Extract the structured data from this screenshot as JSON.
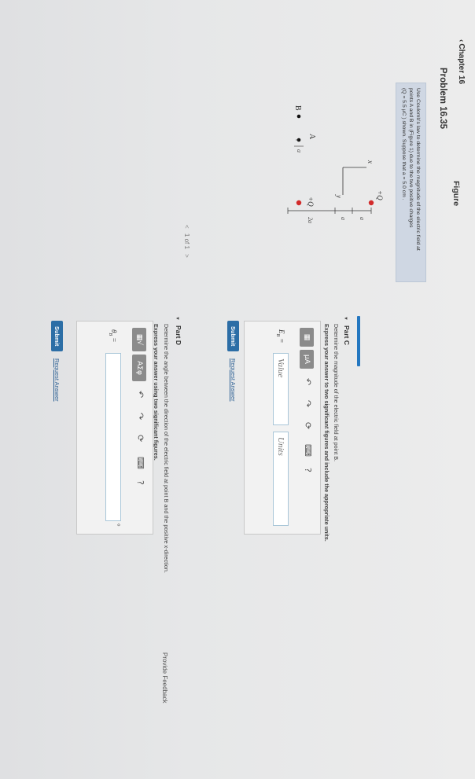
{
  "nav": {
    "chapter": "Chapter 16",
    "problem_title": "Problem 16.35"
  },
  "problem": {
    "text_line1": "Use Coulomb's law to determine the magnitude of the electric field at",
    "text_line2": "points A and B in (Figure 1) due to the two positive charges",
    "text_line3": "(Q = 5.5  μC ) shown. Suppose that a = 5.0  cm ."
  },
  "figure": {
    "label": "Figure",
    "pager_current": "1 of 1",
    "prev_glyph": "<",
    "next_glyph": ">",
    "labels": {
      "point_b": "B",
      "point_a": "A",
      "charge_left": "+Q",
      "charge_right": "+Q",
      "a1": "a",
      "a2": "a",
      "a3": "a",
      "two_a": "2a",
      "x_axis": "x",
      "y_axis": "y"
    },
    "colors": {
      "charge": "#d22b2b"
    }
  },
  "part_c": {
    "title": "Part C",
    "description": "Determine the magnitude of the electric field at point B.",
    "instruction": "Express your answer to two significant figures and include the appropriate units.",
    "variable": "E",
    "variable_sub": "B",
    "value_placeholder": "Value",
    "units_placeholder": "Units",
    "toolbar": {
      "templates_icon": "templates-icon",
      "units_icon_label": "μA",
      "undo_icon": "undo-icon",
      "redo_icon": "redo-icon",
      "reset_icon": "reset-icon",
      "keyboard_icon": "keyboard-icon",
      "help_label": "?"
    },
    "submit_label": "Submit",
    "request_label": "Request Answer"
  },
  "part_d": {
    "title": "Part D",
    "description": "Determine the angle between the direction of the electric field at point B and the positive x-direction.",
    "instruction": "Express your answer using two significant figures.",
    "variable": "θ",
    "variable_sub": "B",
    "answer_value": "",
    "unit_symbol": "°",
    "toolbar": {
      "templates_icon": "templates-icon",
      "greek_label": "ΑΣφ",
      "undo_icon": "undo-icon",
      "redo_icon": "redo-icon",
      "reset_icon": "reset-icon",
      "keyboard_icon": "keyboard-icon",
      "help_label": "?"
    },
    "submit_label": "Submit",
    "request_label": "Request Answer"
  },
  "footer": {
    "feedback_label": "Provide Feedback"
  },
  "colors": {
    "accent": "#2477c0",
    "submit": "#2c6ea6",
    "link": "#2b5f93",
    "question_bg": "#cfd7e3"
  }
}
